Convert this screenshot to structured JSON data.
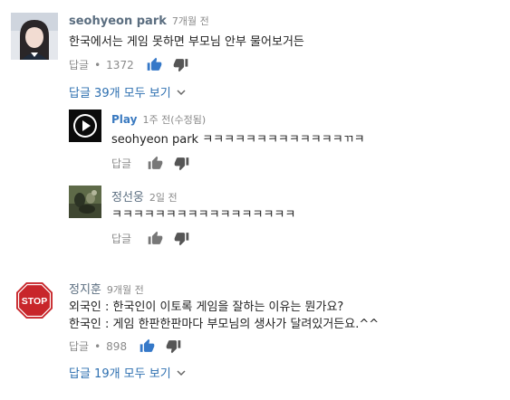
{
  "comments": [
    {
      "author": "seohyeon park",
      "time": "7개월 전",
      "text": "한국에서는 게임 못하면 부모님 안부 물어보거든",
      "reply_label": "답글",
      "likes": "1372",
      "view_replies": "답글 39개 모두 보기",
      "replies": [
        {
          "author": "Play",
          "time": "1주 전(수정됨)",
          "text": "seohyeon park ㅋㅋㅋㅋㅋㅋㅋㅋㅋㅋㅋㅋㅋㄲㅋ",
          "reply_label": "답글"
        },
        {
          "author": "정선웅",
          "time": "2일 전",
          "text": "ㅋㅋㅋㅋㅋㅋㅋㅋㅋㅋㅋㅋㅋㅋㅋㅋㅋ",
          "reply_label": "답글"
        }
      ]
    },
    {
      "author": "정지훈",
      "time": "9개월 전",
      "text_lines": [
        "외국인 : 한국인이 이토록 게임을 잘하는 이유는 뭔가요?",
        "한국인 : 게임 한판한판마다 부모님의 생사가 달려있거든요.^^"
      ],
      "avatar_text": "STOP",
      "reply_label": "답글",
      "likes": "898",
      "view_replies": "답글 19개 모두 보기"
    }
  ],
  "colors": {
    "link": "#2d6fb0",
    "like_active": "#3578c8",
    "meta": "#8a8a8a",
    "stop_red": "#c8262b"
  },
  "icons": [
    "thumbs-up-icon",
    "thumbs-down-icon",
    "chevron-down-icon",
    "play-icon",
    "stop-sign-icon"
  ]
}
